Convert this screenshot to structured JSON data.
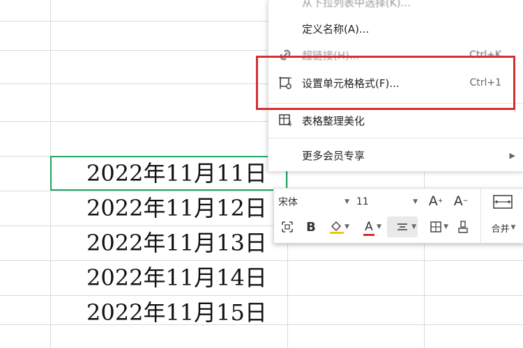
{
  "sheet": {
    "cells": [
      "2022年11月11日",
      "2022年11月12日",
      "2022年11月13日",
      "2022年11月14日",
      "2022年11月15日"
    ],
    "selection_color": "#21a366"
  },
  "context_menu": {
    "items": [
      {
        "label": "从下拉列表中选择(K)...",
        "icon": "list-icon"
      },
      {
        "label": "定义名称(A)...",
        "icon": ""
      },
      {
        "label": "超链接(H)...",
        "shortcut": "Ctrl+K",
        "icon": "link-icon"
      },
      {
        "label": "设置单元格格式(F)...",
        "shortcut": "Ctrl+1",
        "icon": "format-cells-icon"
      },
      {
        "label": "表格整理美化",
        "icon": "table-beautify-icon"
      },
      {
        "label": "更多会员专享",
        "icon": "",
        "submenu": true
      }
    ],
    "highlight_color": "#d32f2f"
  },
  "mini_toolbar": {
    "font_name": "宋体",
    "font_size": "11",
    "bold_label": "B",
    "font_color_label": "A",
    "merge_label": "合并",
    "increase_font_label": "A",
    "decrease_font_label": "A",
    "font_color": "#d32f2f",
    "fill_color": "#f5c400"
  }
}
